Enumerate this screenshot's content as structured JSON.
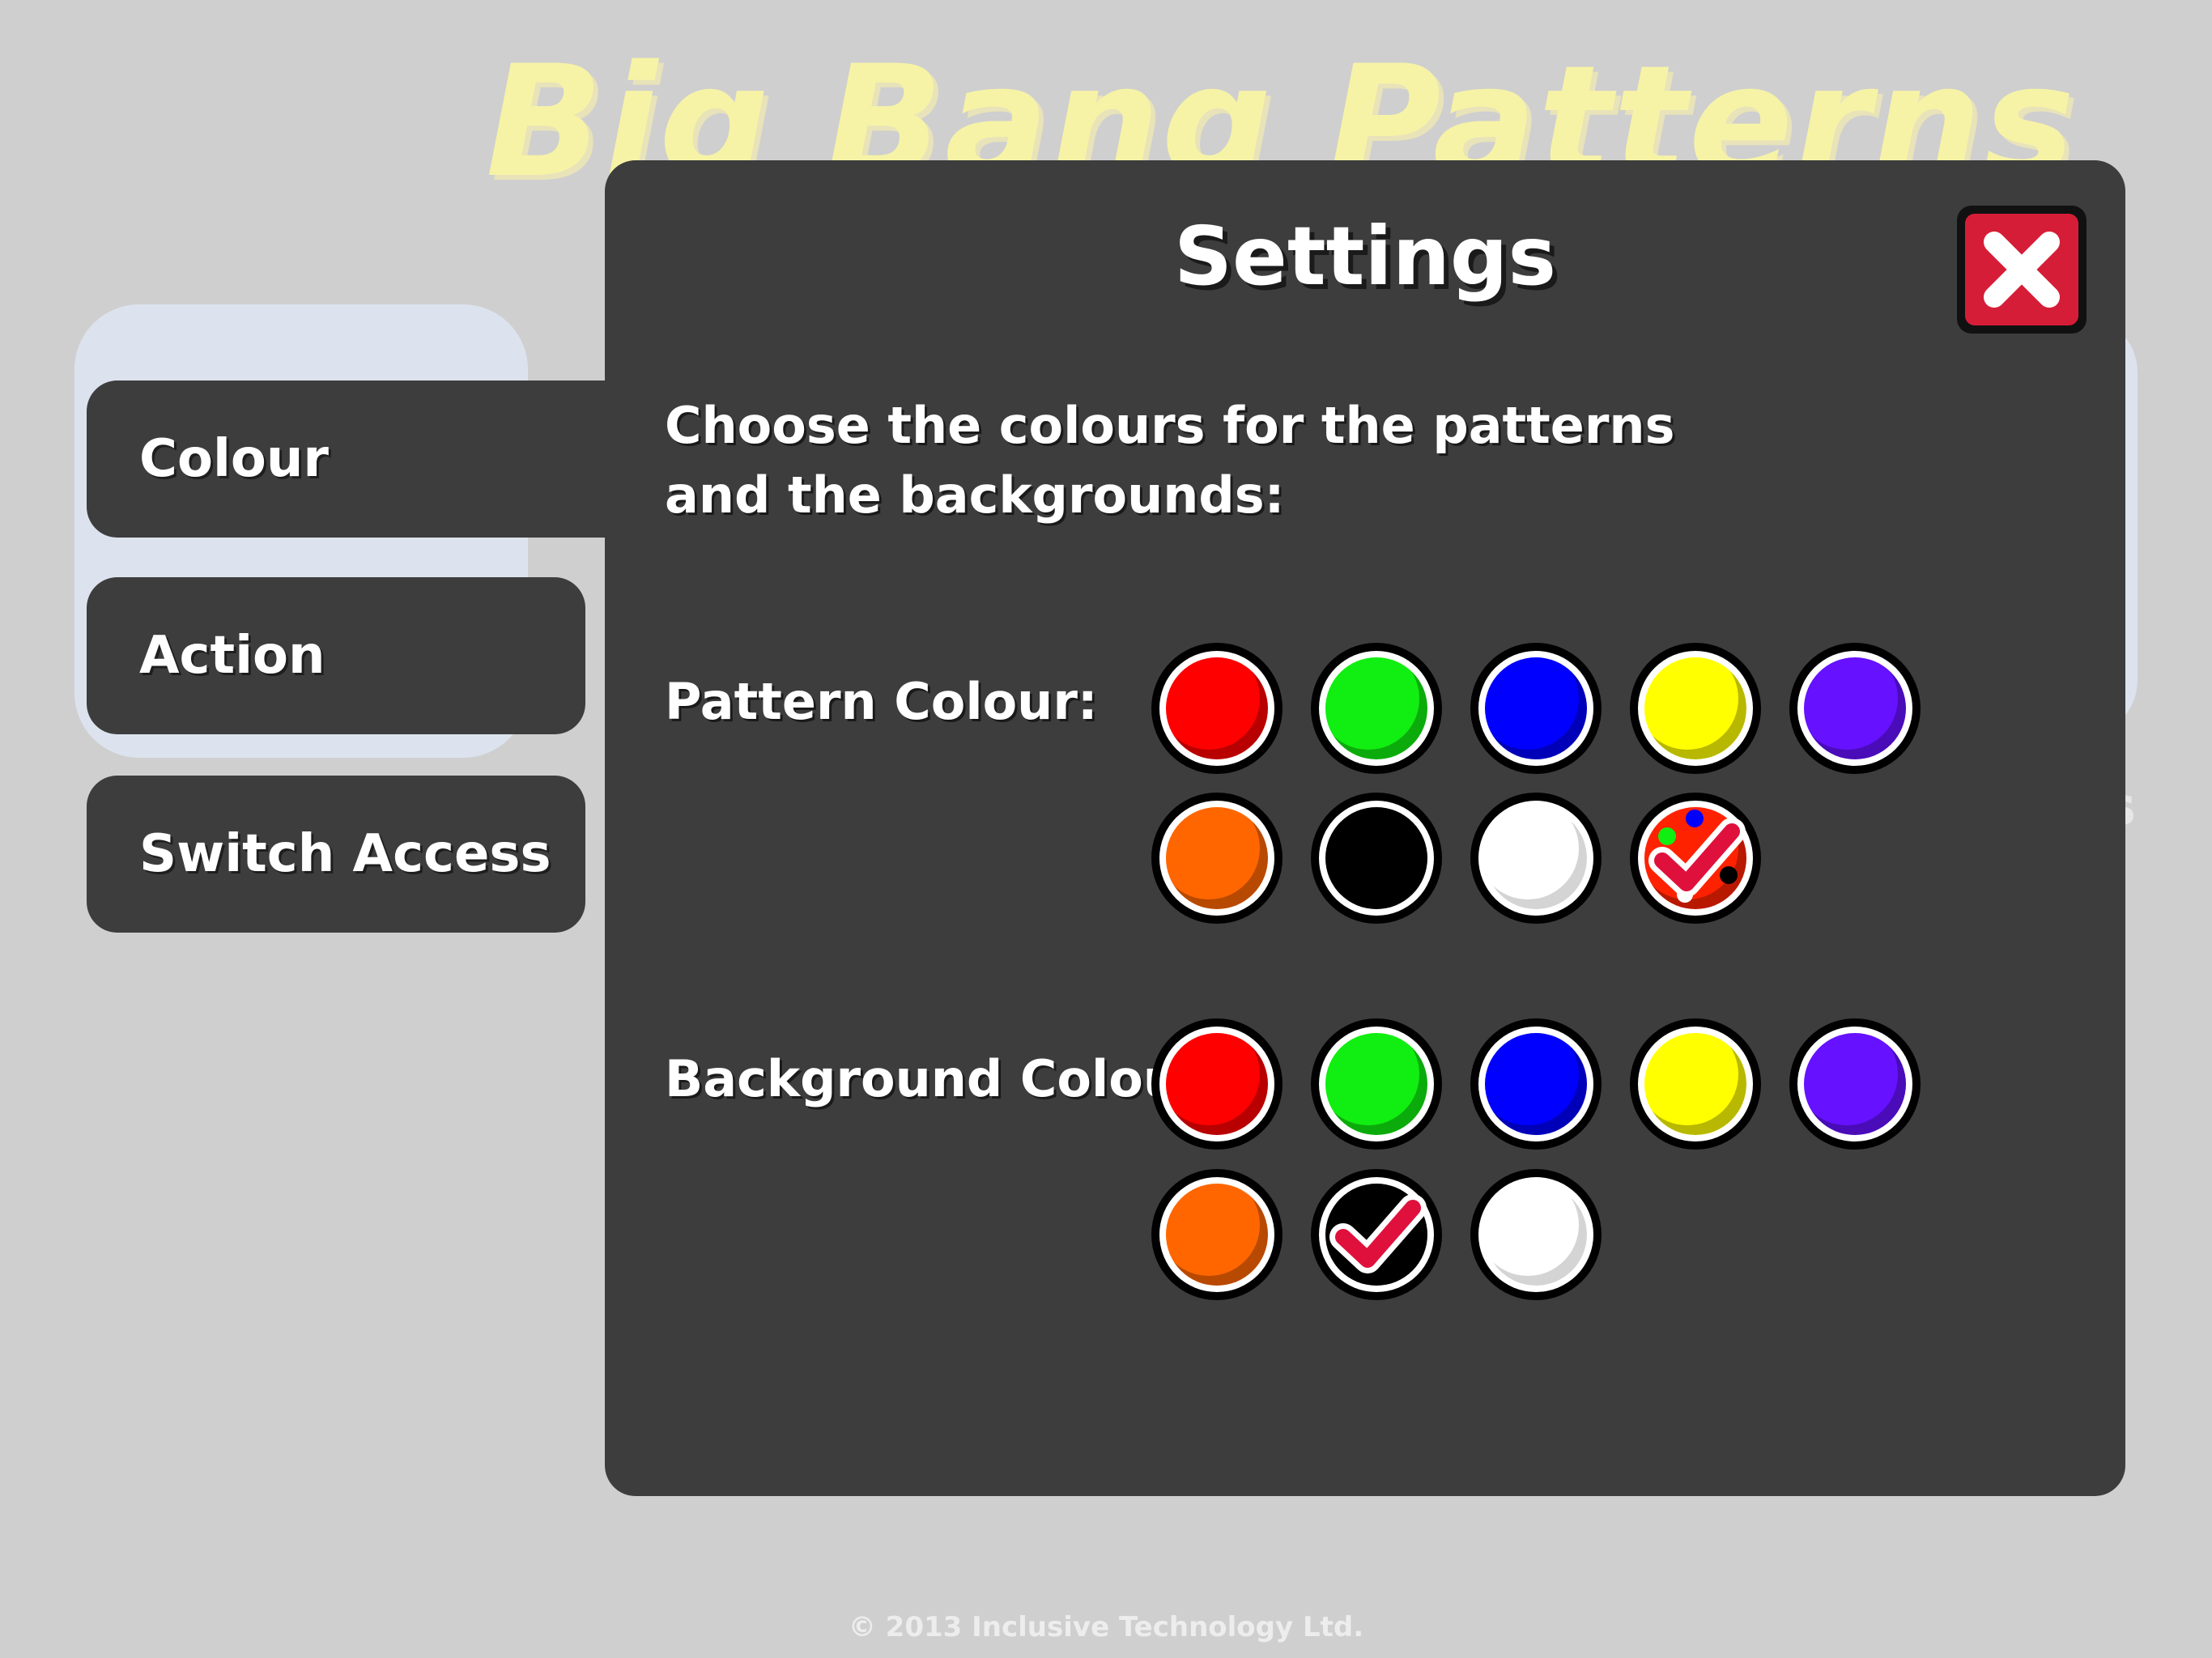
{
  "background_app": {
    "title": "Big Bang Patterns",
    "partial_text": "s",
    "footer": "© 2013 Inclusive Technology Ltd."
  },
  "tabs": [
    {
      "label": "Colour",
      "active": true
    },
    {
      "label": "Action",
      "active": false
    },
    {
      "label": "Switch Access",
      "active": false
    }
  ],
  "settings": {
    "title": "Settings",
    "instructions_line1": "Choose the colours for the patterns",
    "instructions_line2": "and the backgrounds:",
    "pattern_label": "Pattern Colour:",
    "background_label": "Background Colour:",
    "pattern_colours": [
      {
        "name": "red",
        "color": "#ff0000"
      },
      {
        "name": "green",
        "color": "#11ee11"
      },
      {
        "name": "blue",
        "color": "#0000ff"
      },
      {
        "name": "yellow",
        "color": "#ffff00"
      },
      {
        "name": "purple",
        "color": "#6611ff"
      },
      {
        "name": "orange",
        "color": "#ff6600"
      },
      {
        "name": "black",
        "color": "#000000"
      },
      {
        "name": "white",
        "color": "#ffffff"
      },
      {
        "name": "multicolour",
        "color": "#ff2200",
        "selected": true
      }
    ],
    "background_colours": [
      {
        "name": "red",
        "color": "#ff0000"
      },
      {
        "name": "green",
        "color": "#11ee11"
      },
      {
        "name": "blue",
        "color": "#0000ff"
      },
      {
        "name": "yellow",
        "color": "#ffff00"
      },
      {
        "name": "purple",
        "color": "#6611ff"
      },
      {
        "name": "orange",
        "color": "#ff6600"
      },
      {
        "name": "black",
        "color": "#000000",
        "selected": true
      },
      {
        "name": "white",
        "color": "#ffffff"
      }
    ],
    "checkmark_color": "#e0103c",
    "close_color": "#d61d37"
  }
}
